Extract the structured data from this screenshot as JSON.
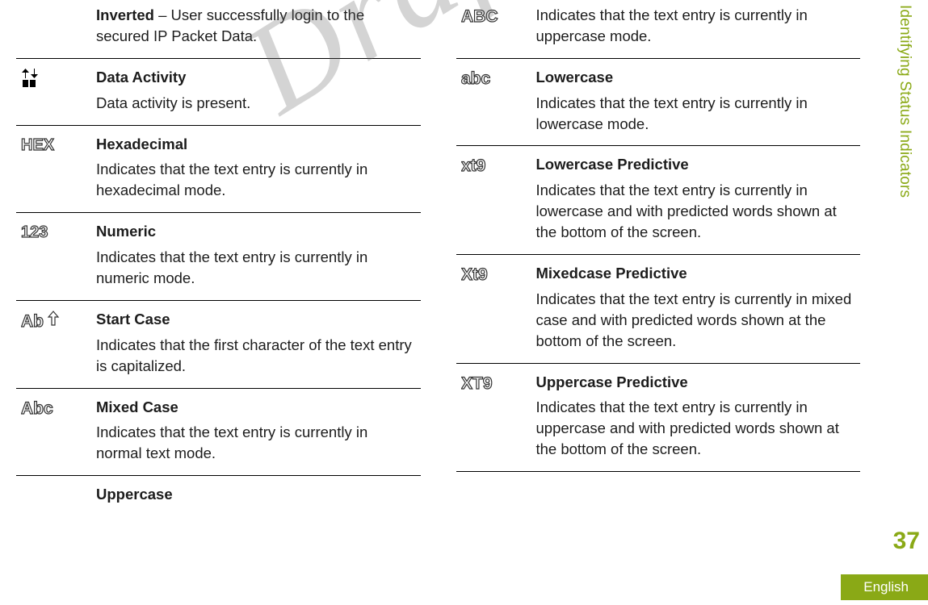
{
  "sidebar_title": "Identifying Status Indicators",
  "page_number": "37",
  "language": "English",
  "watermark": "Draft",
  "left_column": [
    {
      "icon": null,
      "inline_title": "Inverted",
      "desc": " – User successfully login to the secured IP Packet Data."
    },
    {
      "icon": "data-activity",
      "title": "Data Activity",
      "desc": "Data activity is present."
    },
    {
      "icon": "HEX",
      "title": "Hexadecimal",
      "desc": "Indicates that the text entry is currently in hexadecimal mode."
    },
    {
      "icon": "123",
      "title": "Numeric",
      "desc": "Indicates that the text entry is currently in numeric mode."
    },
    {
      "icon": "Ab↑",
      "title": "Start Case",
      "desc": "Indicates that the first character of the text entry is capitalized."
    },
    {
      "icon": "Abc",
      "title": "Mixed Case",
      "desc": "Indicates that the text entry is currently in normal text mode."
    },
    {
      "icon": null,
      "title": "Uppercase",
      "desc": ""
    }
  ],
  "right_column": [
    {
      "icon": "ABC",
      "title": "",
      "desc": "Indicates that the text entry is currently in uppercase mode."
    },
    {
      "icon": "abc",
      "title": "Lowercase",
      "desc": "Indicates that the text entry is currently in lowercase mode."
    },
    {
      "icon": "xt9",
      "title": "Lowercase Predictive",
      "desc": "Indicates that the text entry is currently in lowercase and with predicted words shown at the bottom of the screen."
    },
    {
      "icon": "Xt9",
      "title": "Mixedcase Predictive",
      "desc": "Indicates that the text entry is currently in mixed case and with predicted words shown at the bottom of the screen."
    },
    {
      "icon": "XT9",
      "title": "Uppercase Predictive",
      "desc": "Indicates that the text entry is currently in uppercase and with predicted words shown at the bottom of the screen."
    }
  ]
}
